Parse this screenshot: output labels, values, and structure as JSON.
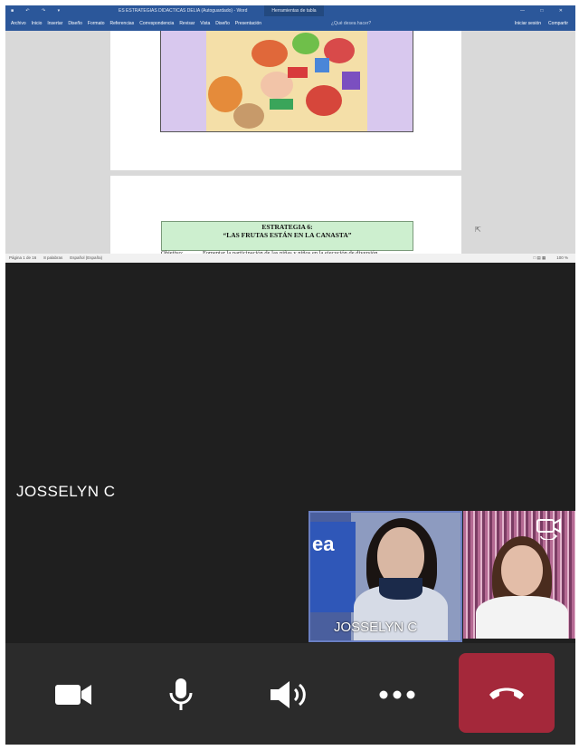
{
  "word": {
    "doc_title": "ES ESTRATEGIAS DIDACTICAS DELIA (Autoguardado) - Word",
    "context_tab": "Herramientas de tabla",
    "ribbon_tabs": [
      "Archivo",
      "Inicio",
      "Insertar",
      "Diseño",
      "Formato",
      "Referencias",
      "Correspondencia",
      "Revisar",
      "Vista",
      "Diseño",
      "Presentación"
    ],
    "tell_me": "¿Qué desea hacer?",
    "sign_in": "Iniciar sesión",
    "share": "Compartir",
    "strategy_title": "ESTRATEGIA 6:",
    "strategy_name": "“LAS FRUTAS ESTÁN EN LA CANASTA”",
    "objective_label": "Objetivo:",
    "objective_text": "Fomentar la participación de las niñas y niños en la ejecución de diversión",
    "status_page": "Página 1 de 16",
    "status_words": "8 palabras",
    "status_lang": "Español (España)",
    "zoom": "100 %"
  },
  "call": {
    "main_participant": "JOSSELYN C",
    "self_tile_label": "JOSSELYN C",
    "self_tile_logo": "ea"
  },
  "controls": {
    "camera": "video-camera-icon",
    "mic": "microphone-icon",
    "speaker": "speaker-icon",
    "more": "more-options-icon",
    "hangup": "hang-up-icon",
    "hangup_color": "#a4283a"
  }
}
